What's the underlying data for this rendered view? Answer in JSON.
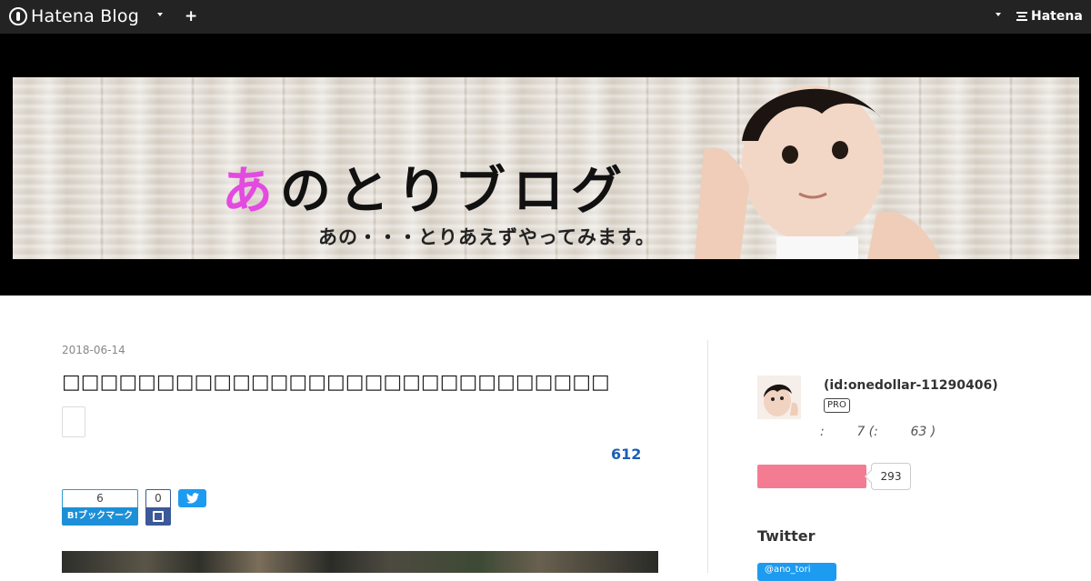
{
  "topbar": {
    "logo_text": "Hatena Blog",
    "plus_label": "+",
    "right_brand": "Hatena"
  },
  "header": {
    "banner_title_accent": "あ",
    "banner_title_rest": "のとりブログ",
    "banner_subtitle": "あの・・・とりあえずやってみます。"
  },
  "post": {
    "date": "2018-06-14",
    "title": "□□□□□□□□□□□□□□□□□□□□□□□□□□□□□",
    "count": "612",
    "share": {
      "hatena_count": "6",
      "hatena_label": "B!ブックマーク",
      "facebook_count": "0"
    }
  },
  "sidebar": {
    "user_id": "(id:onedollar-11290406)",
    "pro_badge": "PRO",
    "stats_text": ":        7 (:        63 )",
    "reader_count": "293",
    "twitter_heading": "Twitter",
    "twitter_follow": "@ano_tori"
  },
  "colors": {
    "topbar_bg": "#232323",
    "accent_pink": "#e34be0",
    "reader_button": "#f37c93",
    "hatena_blue": "#1d8fd8",
    "facebook_blue": "#3b5998",
    "twitter_blue": "#1d9bf0",
    "count_blue": "#1a5fb4"
  }
}
